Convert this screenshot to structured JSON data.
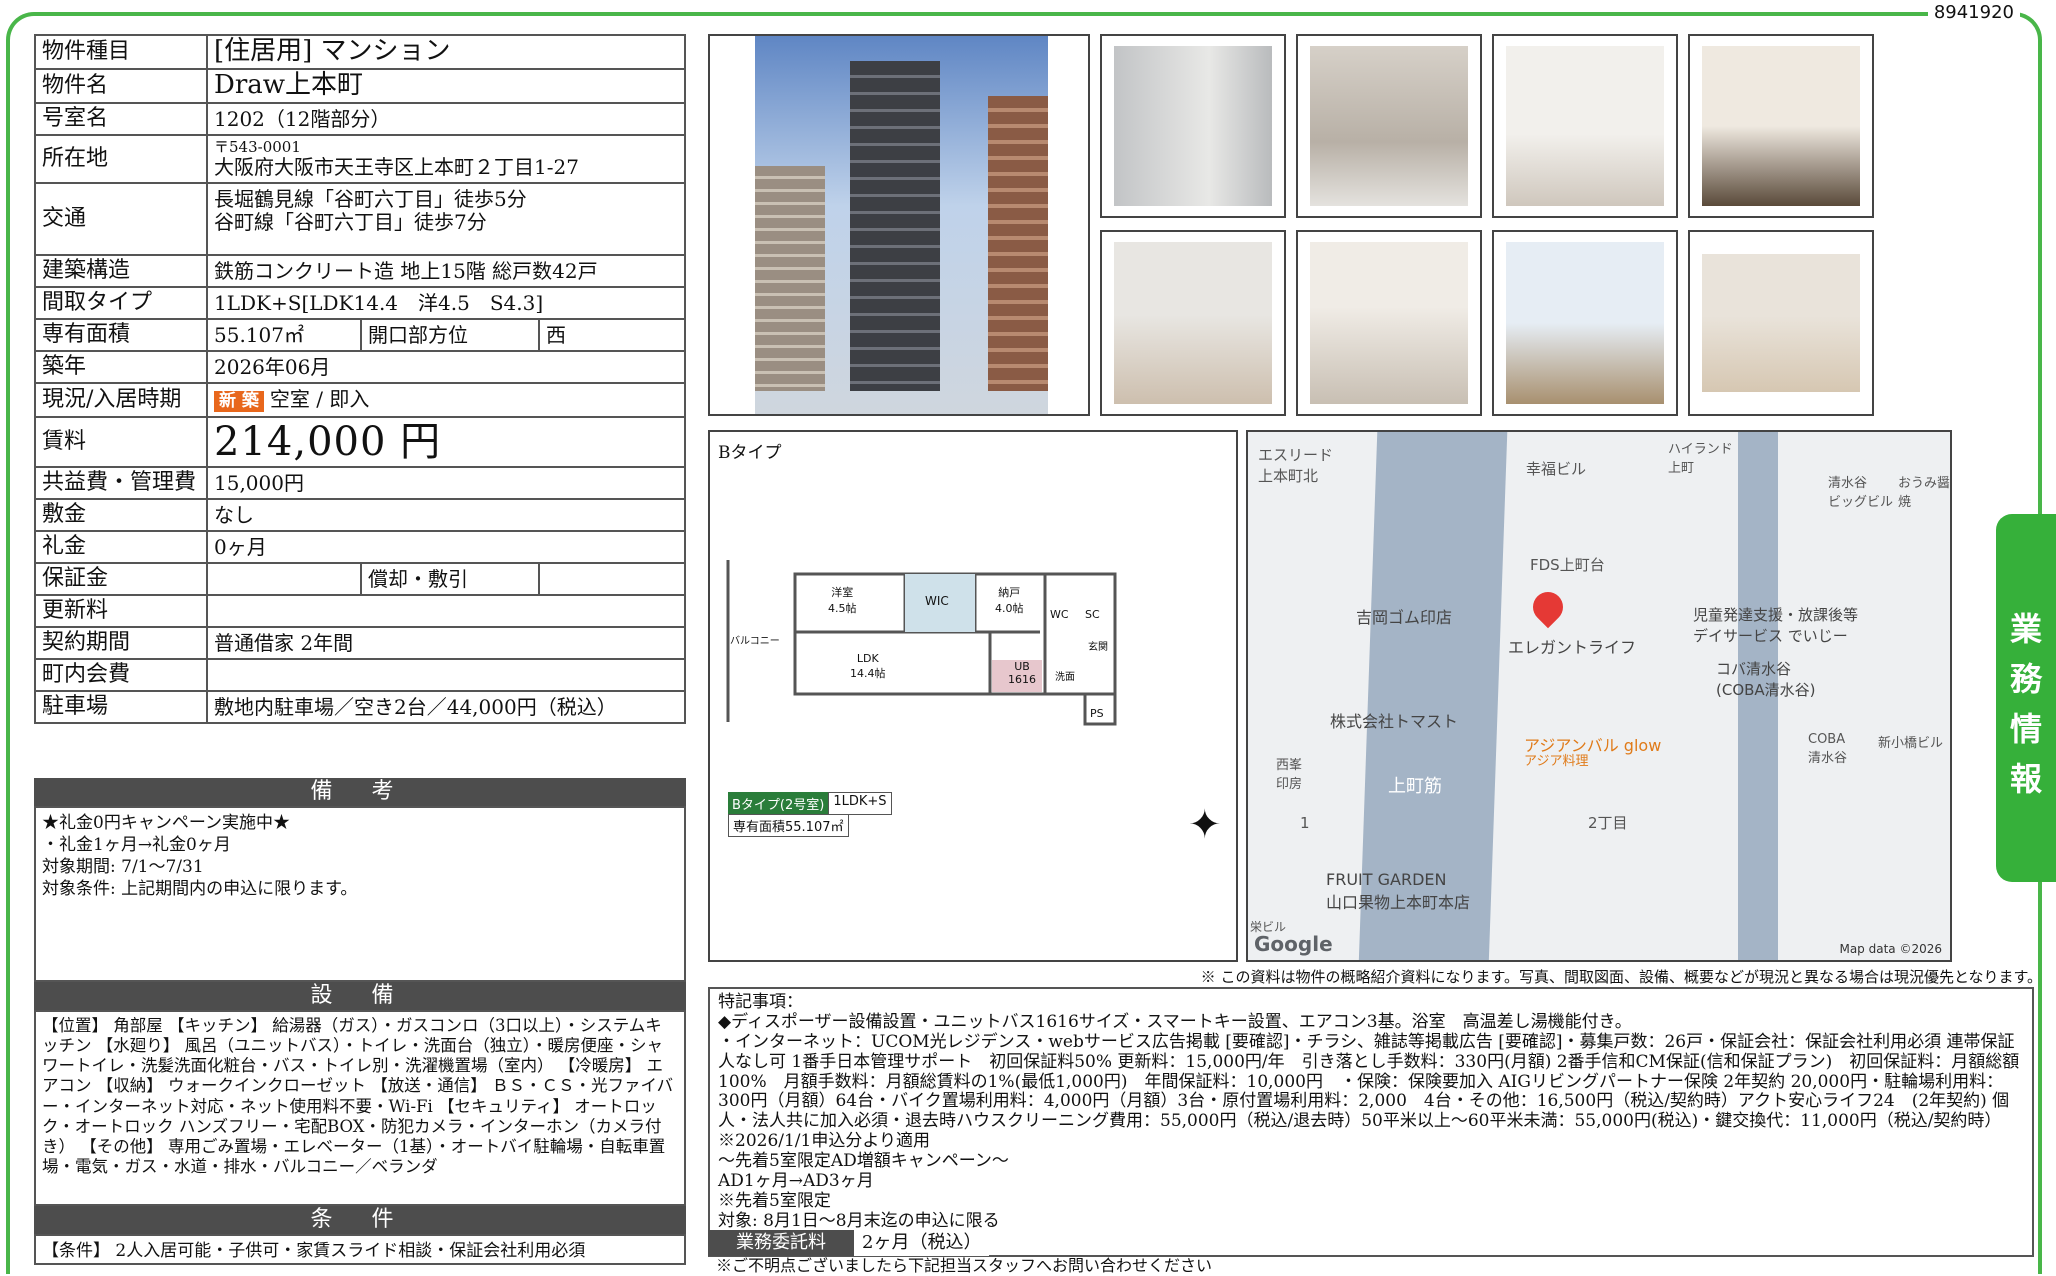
{
  "doc_id": "8941920",
  "spec": {
    "type_label": "物件種目",
    "type_value": "[住居用]  マンション",
    "name_label": "物件名",
    "name_value": "Draw上本町",
    "room_label": "号室名",
    "room_value": "1202（12階部分）",
    "addr_label": "所在地",
    "addr_zip": "〒543-0001",
    "addr_value": "大阪府大阪市天王寺区上本町２丁目1-27",
    "access_label": "交通",
    "access_1": "長堀鶴見線「谷町六丁目」徒歩5分",
    "access_2": "谷町線「谷町六丁目」徒歩7分",
    "struct_label": "建築構造",
    "struct_value": "鉄筋コンクリート造 地上15階 総戸数42戸",
    "layout_label": "間取タイプ",
    "layout_value": "1LDK+S[LDK14.4　洋4.5　S4.3]",
    "area_label": "専有面積",
    "area_value": "55.107㎡",
    "dir_label": "開口部方位",
    "dir_value": "西",
    "built_label": "築年",
    "built_value": "2026年06月",
    "status_label": "現況/入居時期",
    "status_badge": "新 築",
    "status_value": "空室 / 即入",
    "rent_label": "賃料",
    "rent_value": "214,000 円",
    "fee_label": "共益費・管理費",
    "fee_value": "15,000円",
    "deposit_label": "敷金",
    "deposit_value": "なし",
    "keymoney_label": "礼金",
    "keymoney_value": "0ヶ月",
    "guarantee_label": "保証金",
    "amort_label": "償却・敷引",
    "renew_label": "更新料",
    "term_label": "契約期間",
    "term_value": "普通借家 2年間",
    "assoc_label": "町内会費",
    "parking_label": "駐車場",
    "parking_value": "敷地内駐車場／空き2台／44,000円（税込）"
  },
  "remarks": {
    "header": "備 考",
    "text": "★礼金0円キャンペーン実施中★\n・礼金1ヶ月→礼金0ヶ月\n対象期間: 7/1〜7/31\n対象条件: 上記期間内の申込に限ります。"
  },
  "facilities": {
    "header": "設 備",
    "text": "【位置】 角部屋 【キッチン】 給湯器（ガス）・ガスコンロ（3口以上）・システムキッチン 【水廻り】 風呂（ユニットバス）・トイレ・洗面台（独立）・暖房便座・シャワートイレ・洗髪洗面化粧台・バス・トイレ別・洗濯機置場（室内） 【冷暖房】 エアコン 【収納】 ウォークインクローゼット 【放送・通信】 ＢＳ・ＣＳ・光ファイバー・インターネット対応・ネット使用料不要・Wi-Fi 【セキュリティ】 オートロック・オートロック ハンズフリー・宅配BOX・防犯カメラ・インターホン（カメラ付き） 【その他】 専用ごみ置場・エレベーター（1基）・オートバイ駐輪場・自転車置場・電気・ガス・水道・排水・バルコニー／ベランダ"
  },
  "conditions": {
    "header": "条 件",
    "text": "【条件】 2人入居可能・子供可・家賃スライド相談・保証会社利用必須"
  },
  "floorplan": {
    "title": "Bタイプ",
    "rooms": [
      "洋室\n4.5帖",
      "WIC",
      "納戸\n4.0帖",
      "WC",
      "SC",
      "LDK\n14.4帖",
      "UB\n1616",
      "洗面",
      "玄関",
      "PS",
      "バルコニー"
    ],
    "type_tag": "Bタイプ(2号室)",
    "type_layout": "1LDK+S",
    "area_tag": "専有面積55.107㎡"
  },
  "map": {
    "labels": [
      "エスリード\n上本町北",
      "幸福ビル",
      "ハイランド\n上町",
      "清水谷\nビッグビル",
      "おうみ醤焼",
      "FDS上町台",
      "エレガントライフ",
      "吉岡ゴム印店",
      "児童発達支援・放課後等\nデイサービス でいじー",
      "コバ清水谷\n(COBA清水谷)",
      "株式会社トマスト",
      "アジアンバル glow",
      "アジア料理",
      "西峯\n印房",
      "上町筋",
      "2丁目",
      "1",
      "COBA\n清水谷",
      "新小橋ビル",
      "FRUIT GARDEN\n山口果物上本町本店",
      "栄ビル"
    ],
    "google": "Google",
    "mapdata": "Map data ©2026"
  },
  "disclaimer": "※ この資料は物件の概略紹介資料になります。写真、間取図面、設備、概要などが現況と異なる場合は現況優先となります。",
  "notes": "特記事項：\n◆ディスポーザー設備設置・ユニットバス1616サイズ・スマートキー設置、エアコン3基。浴室　高温差し湯機能付き。\n・インターネット：UCOM光レジデンス・webサービス広告掲載 [要確認]・チラシ、雑誌等掲載広告 [要確認]・募集戸数：26戸・保証会社：保証会社利用必須 連帯保証人なし可 1番手日本管理サポート　初回保証料50% 更新料：15,000円/年　引き落とし手数料：330円(月額) 2番手信和CM保証(信和保証プラン)　初回保証料：月額総額100%　月額手数料：月額総賃料の1%(最低1,000円)　年間保証料：10,000円　・保険：保険要加入 AIGリビングパートナー保険 2年契約 20,000円・駐輪場利用料：300円（月額）64台・バイク置場利用料：4,000円（月額）3台・原付置場利用料：2,000　4台・その他：16,500円（税込/契約時）アクト安心ライフ24　(2年契約) 個人・法人共に加入必須・退去時ハウスクリーニング費用：55,000円（税込/退去時）50平米以上〜60平米未満：55,000円(税込)・鍵交換代：11,000円（税込/契約時）※2026/1/1申込分より適用\n〜先着5室限定AD増額キャンペーン〜\nAD1ヶ月→AD3ヶ月\n※先着5室限定\n対象: 8月1日〜8月末迄の申込に限る",
  "commission": {
    "label": "業務委託料",
    "value": "2ヶ月（税込）",
    "trailing": "※ご不明点ございましたら下記担当スタッフへお問い合わせください"
  },
  "side_tab": [
    "業",
    "務",
    "情",
    "報"
  ],
  "colors": {
    "green": "#49b649",
    "dark": "#4d4d4d",
    "orange": "#e8671c"
  }
}
